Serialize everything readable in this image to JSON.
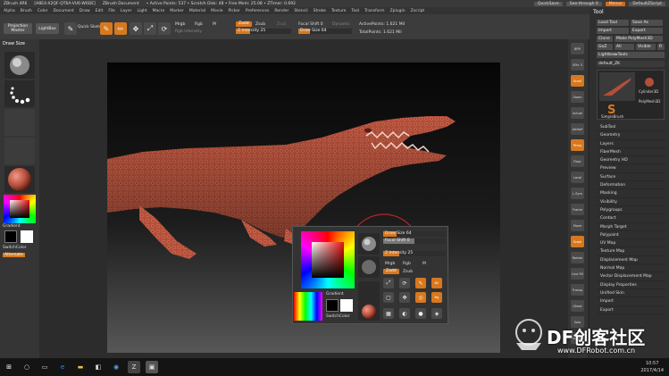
{
  "titlebar": {
    "app": "ZBrush 4R6",
    "version": "[ABE4-X2QF-QT6A-VU6-W6DE]",
    "doc": "ZBrush Document",
    "points": "• Active Points: 537 • Scratch Disk: 48 • Free Mem: 25.08 • ZTimer: 0.692",
    "quicksave": "QuickSave",
    "seethrough": "See-through 0",
    "menus": "Menus",
    "defaultscript": "DefaultZScript"
  },
  "menubar": [
    "Alpha",
    "Brush",
    "Color",
    "Document",
    "Draw",
    "Edit",
    "File",
    "Layer",
    "Light",
    "Macro",
    "Marker",
    "Material",
    "Movie",
    "Picker",
    "Preferences",
    "Render",
    "Stencil",
    "Stroke",
    "Texture",
    "Tool",
    "Transform",
    "Zplugin",
    "Zscript"
  ],
  "toolbar": {
    "projection_master": "Projection Master",
    "lightbox": "LightBox",
    "quick_sketch": "Quick Sketch",
    "edit": "Edit",
    "draw": "Draw",
    "move": "Move",
    "scale": "Scale",
    "rotate": "Rotate",
    "mrgb": "Mrgb",
    "rgb": "Rgb",
    "m": "M",
    "rgb_intensity": "Rgb Intensity",
    "zadd": "Zadd",
    "zsub": "Zsub",
    "zcut": "Zcut",
    "z_intensity": "Z Intensity 25",
    "focal_shift": "Focal Shift 0",
    "draw_size": "Draw Size 64",
    "dynamic": "Dynamic",
    "active_points": "ActivePoints: 1.621 Mil",
    "total_points": "TotalPoints: 1.621 Mil"
  },
  "left": {
    "brush": "Draw Size",
    "gradient": "Gradient",
    "switchcolor": "SwitchColor",
    "alternate": "Alternate"
  },
  "right_strip": [
    "BPR",
    "SPix 3",
    "Scroll",
    "Zoom",
    "Actual",
    "AAHalf",
    "Persp",
    "Floor",
    "Local",
    "L.Sym",
    "Frame",
    "Move",
    "Scale",
    "Rotate",
    "Line Fill",
    "Transp",
    "Ghost",
    "Solo",
    "Xpose"
  ],
  "tray": {
    "title": "Tool",
    "buttons": [
      "Load Tool",
      "Save As",
      "Import",
      "Export",
      "Clone",
      "Make PolyMesh3D",
      "GoZ",
      "All",
      "Visible",
      "R"
    ],
    "lightbox_tools": "Lightbox▸Tools",
    "current_tool": "default_ZK",
    "subtools": [
      "Cylinder3D",
      "PolyMesh3D",
      "SimpleBrush"
    ],
    "list": [
      "SubTool",
      "Geometry",
      "Layers",
      "FiberMesh",
      "Geometry HD",
      "Preview",
      "Surface",
      "Deformation",
      "Masking",
      "Visibility",
      "Polygroups",
      "Contact",
      "Morph Target",
      "Polypaint",
      "UV Map",
      "Texture Map",
      "Displacement Map",
      "Normal Map",
      "Vector Displacement Map",
      "Display Properties",
      "Unified Skin",
      "Import",
      "Export"
    ]
  },
  "popup": {
    "draw_size": "Draw Size 64",
    "focal_shift": "Focal Shift 0",
    "z_intensity": "Z Intensity 25",
    "mrgb": "Mrgb",
    "rgb": "Rgb",
    "m": "M",
    "zadd": "Zadd",
    "zsub": "Zsub",
    "gradient": "Gradient",
    "switchcolor": "SwitchColor"
  },
  "taskbar": {
    "time": "10:57",
    "date": "2017/4/14"
  },
  "watermark": {
    "brand": "DF创客社区",
    "url": "www.DFRobot.com.cn"
  },
  "colors": {
    "accent": "#d8781e",
    "model": "#b54e3a",
    "bg": "#2a2a2a"
  }
}
